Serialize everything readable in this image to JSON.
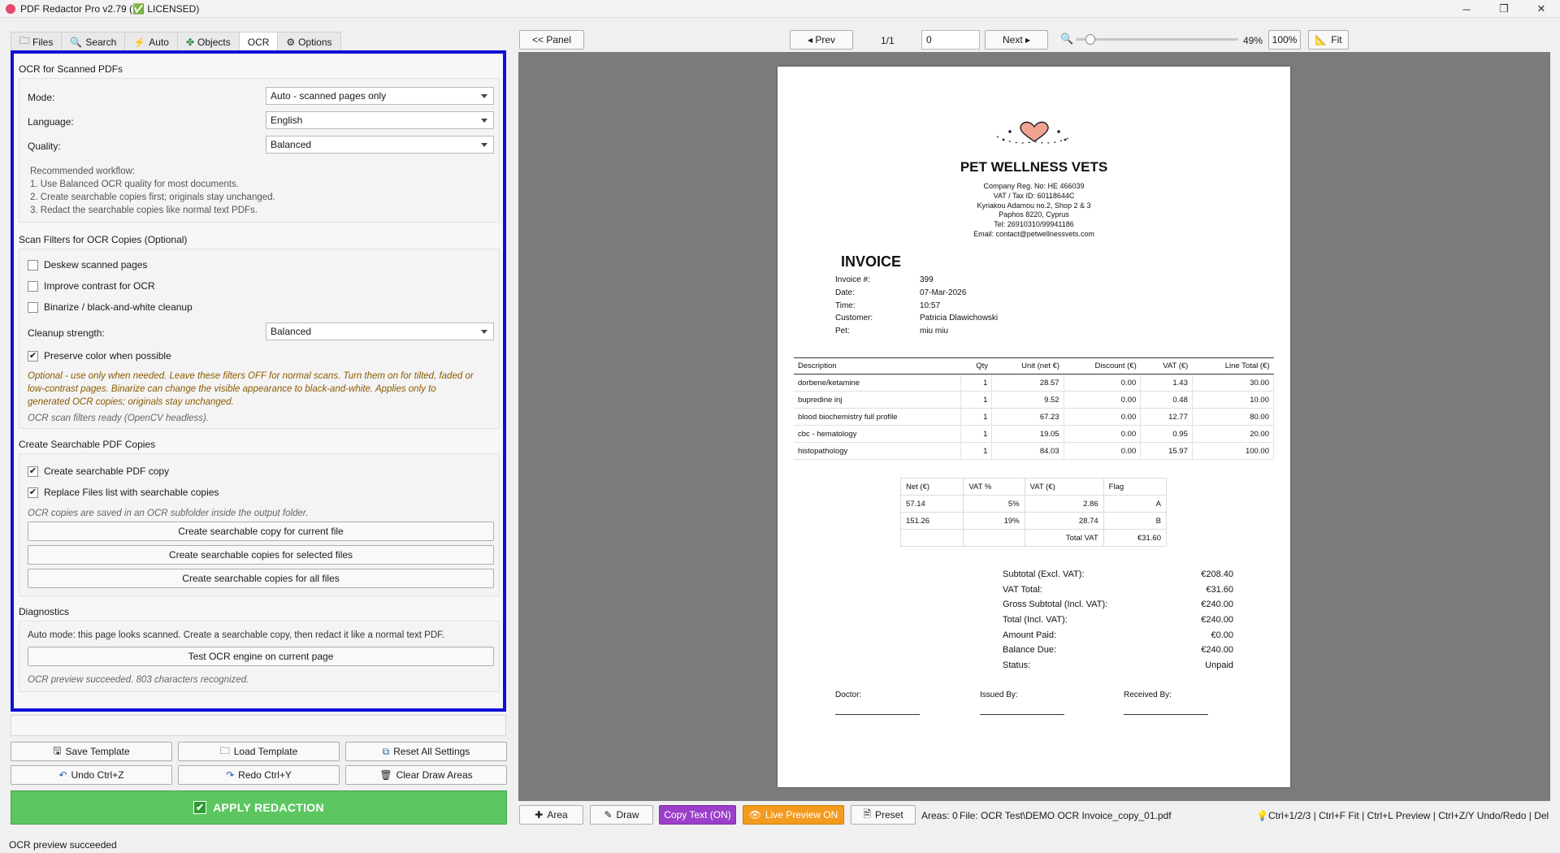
{
  "window": {
    "title": "PDF Redactor Pro v2.79 (✅ LICENSED)",
    "minimize": "─",
    "maximize": "❐",
    "close": "✕"
  },
  "tabs": [
    {
      "label": "Files",
      "icon": "folder-icon"
    },
    {
      "label": "Search",
      "icon": "search-icon"
    },
    {
      "label": "Auto",
      "icon": "lightning-icon"
    },
    {
      "label": "Objects",
      "icon": "puzzle-icon"
    },
    {
      "label": "OCR",
      "icon": ""
    },
    {
      "label": "Options",
      "icon": "gear-icon"
    }
  ],
  "ocr": {
    "section_title": "OCR for Scanned PDFs",
    "mode_label": "Mode:",
    "mode_value": "Auto - scanned pages only",
    "language_label": "Language:",
    "language_value": "English",
    "quality_label": "Quality:",
    "quality_value": "Balanced",
    "workflow": [
      "Recommended workflow:",
      "1. Use Balanced OCR quality for most documents.",
      "2. Create searchable copies first; originals stay unchanged.",
      "3. Redact the searchable copies like normal text PDFs."
    ]
  },
  "filters": {
    "section_title": "Scan Filters for OCR Copies (Optional)",
    "deskew": "Deskew scanned pages",
    "contrast": "Improve contrast for OCR",
    "binarize": "Binarize / black-and-white cleanup",
    "cleanup_label": "Cleanup strength:",
    "cleanup_value": "Balanced",
    "preserve": "Preserve color when possible",
    "warning": [
      "Optional - use only when needed. Leave these filters OFF for normal scans. Turn them on for tilted, faded or",
      "low-contrast pages. Binarize can change the visible appearance to black-and-white. Applies only to",
      "generated OCR copies; originals stay unchanged."
    ],
    "status": "OCR scan filters ready (OpenCV headless)."
  },
  "searchable": {
    "section_title": "Create Searchable PDF Copies",
    "create_copy": "Create searchable PDF copy",
    "replace_list": "Replace Files list with searchable copies",
    "note": "OCR copies are saved in an OCR subfolder inside the output folder.",
    "btn_current": "Create searchable copy for current file",
    "btn_selected": "Create searchable copies for selected files",
    "btn_all": "Create searchable copies for all files"
  },
  "diagnostics": {
    "section_title": "Diagnostics",
    "info": "Auto mode: this page looks scanned. Create a searchable copy, then redact it like a normal text PDF.",
    "btn_test": "Test OCR engine on current page",
    "result": "OCR preview succeeded. 803 characters recognized."
  },
  "actions": {
    "save_template": "Save Template",
    "load_template": "Load Template",
    "reset": "Reset All Settings",
    "undo": "Undo  Ctrl+Z",
    "redo": "Redo  Ctrl+Y",
    "clear": "Clear Draw Areas",
    "apply": "APPLY REDACTION"
  },
  "status_bar": "OCR preview succeeded",
  "viewer": {
    "panel_btn": "<< Panel",
    "prev": "◂ Prev",
    "page_count": "1/1",
    "page_input": "0",
    "next": "Next ▸",
    "zoom_percent": "49%",
    "zoom_100": "100%",
    "fit": "Fit",
    "zoom_level": 0.49
  },
  "bottom_toolbar": {
    "area": "Area",
    "draw": "Draw",
    "copy_text": "Copy Text (ON)",
    "live_preview": "Live Preview ON",
    "preset": "Preset",
    "areas_count": "Areas: 0",
    "file": "File: OCR Test\\DEMO OCR Invoice_copy_01.pdf",
    "shortcuts": "Ctrl+1/2/3 | Ctrl+F Fit | Ctrl+L Preview | Ctrl+Z/Y Undo/Redo | Del",
    "colors": {
      "copy_text_bg": "#9b3fc9",
      "live_preview_bg": "#f29b1e"
    }
  },
  "invoice": {
    "company": "PET WELLNESS VETS",
    "company_lines": [
      "Company Reg. No: HE 466039",
      "VAT / Tax ID: 60118644C",
      "Kyriakou Adamou no.2, Shop 2 & 3",
      "Paphos 8220, Cyprus",
      "Tel: 26910310/99941186",
      "Email: contact@petwellnessvets.com"
    ],
    "heading": "INVOICE",
    "meta": [
      {
        "k": "Invoice #:",
        "v": "399"
      },
      {
        "k": "Date:",
        "v": "07-Mar-2026"
      },
      {
        "k": "Time:",
        "v": "10:57"
      },
      {
        "k": "Customer:",
        "v": "Patricia Dlawichowski"
      },
      {
        "k": "Pet:",
        "v": "miu miu"
      }
    ],
    "columns": [
      "Description",
      "Qty",
      "Unit (net €)",
      "Discount (€)",
      "VAT (€)",
      "Line Total (€)"
    ],
    "rows": [
      [
        "dorbene/ketamine",
        "1",
        "28.57",
        "0.00",
        "1.43",
        "30.00"
      ],
      [
        "bupredine inj",
        "1",
        "9.52",
        "0.00",
        "0.48",
        "10.00"
      ],
      [
        "blood biochemistry full profile",
        "1",
        "67.23",
        "0.00",
        "12.77",
        "80.00"
      ],
      [
        "cbc - hematology",
        "1",
        "19.05",
        "0.00",
        "0.95",
        "20.00"
      ],
      [
        "histopathology",
        "1",
        "84.03",
        "0.00",
        "15.97",
        "100.00"
      ]
    ],
    "vat_columns": [
      "Net (€)",
      "VAT %",
      "VAT (€)",
      "Flag"
    ],
    "vat_rows": [
      [
        "57.14",
        "5%",
        "2.86",
        "A"
      ],
      [
        "151.26",
        "19%",
        "28.74",
        "B"
      ]
    ],
    "vat_total_label": "Total VAT",
    "vat_total_value": "€31.60",
    "totals": [
      {
        "k": "Subtotal (Excl. VAT):",
        "v": "€208.40"
      },
      {
        "k": "VAT Total:",
        "v": "€31.60"
      },
      {
        "k": "Gross Subtotal (Incl. VAT):",
        "v": "€240.00"
      },
      {
        "k": "Total (Incl. VAT):",
        "v": "€240.00"
      },
      {
        "k": "Amount Paid:",
        "v": "€0.00"
      },
      {
        "k": "Balance Due:",
        "v": "€240.00"
      },
      {
        "k": "Status:",
        "v": "Unpaid"
      }
    ],
    "signatures": [
      "Doctor:",
      "Issued By:",
      "Received By:"
    ]
  }
}
